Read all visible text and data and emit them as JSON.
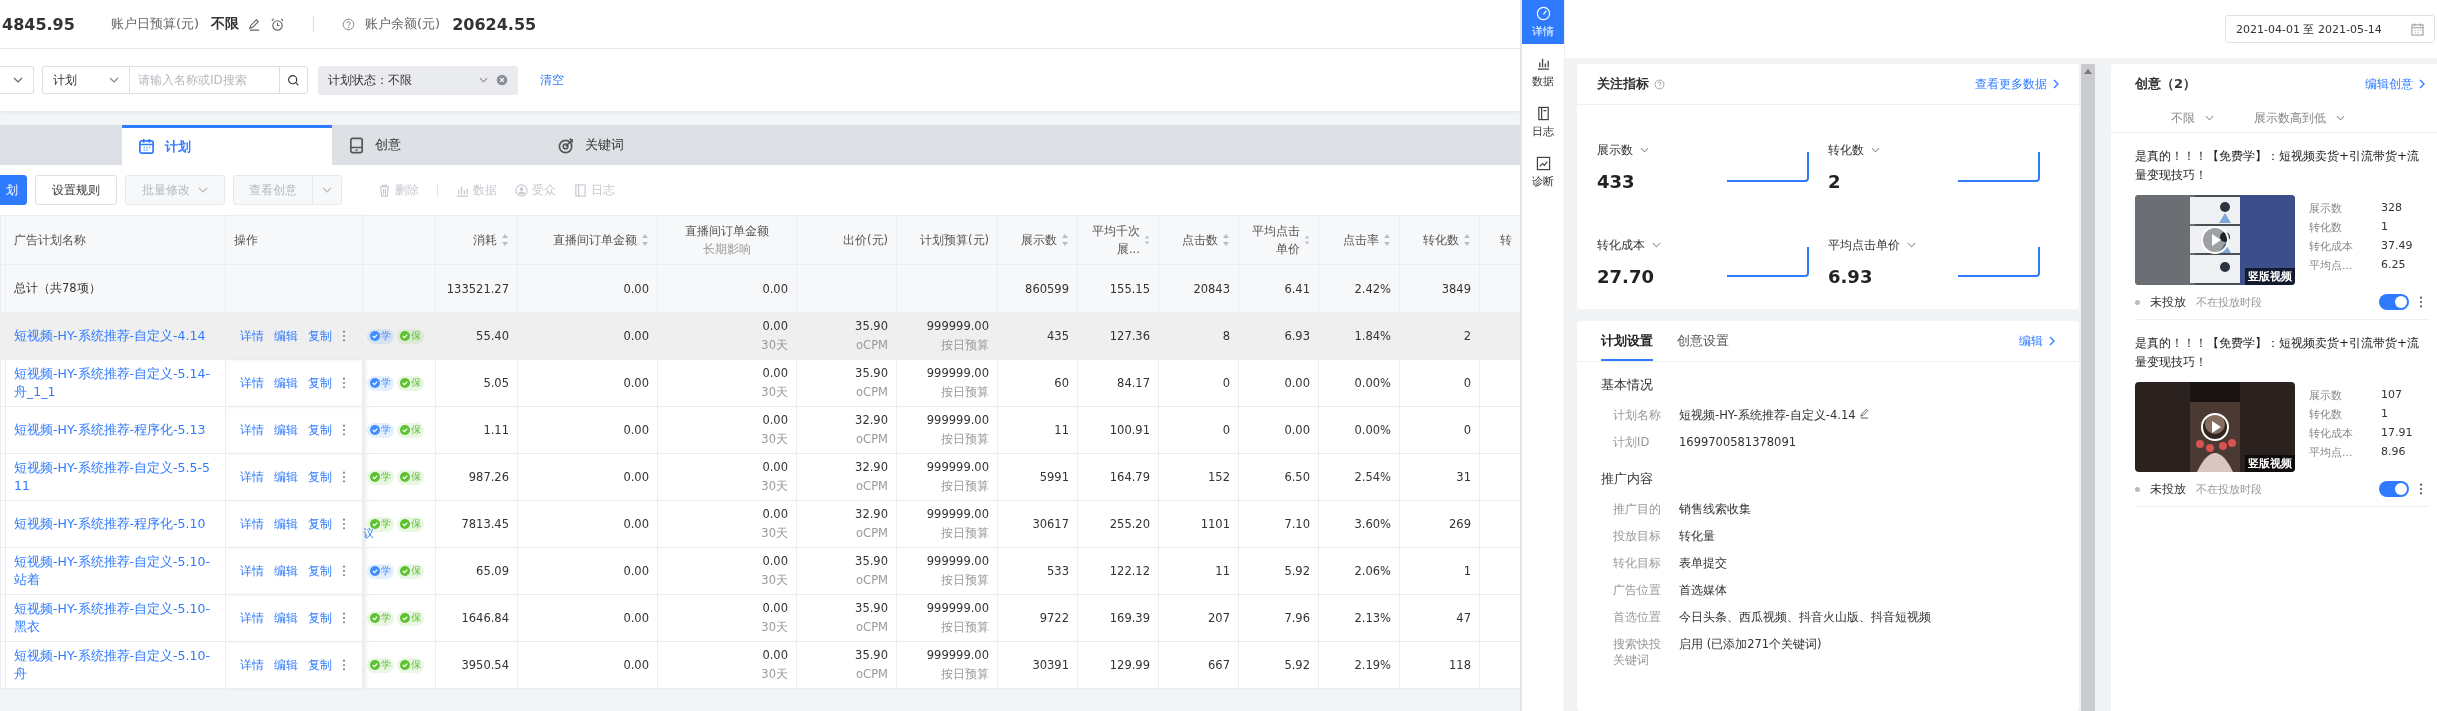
{
  "account": {
    "spend": "4845.95",
    "daily_budget_label": "账户日预算(元)",
    "daily_budget": "不限",
    "balance_label": "账户余额(元)",
    "balance": "20624.55"
  },
  "filters": {
    "level": "计划",
    "search_placeholder": "请输入名称或ID搜索",
    "status_tag": "计划状态：不限",
    "clear": "清空"
  },
  "tabs": [
    {
      "label": "计划",
      "kind": "plan",
      "selected": true
    },
    {
      "label": "创意",
      "kind": "creative",
      "selected": false
    },
    {
      "label": "关键词",
      "kind": "keyword",
      "selected": false
    }
  ],
  "toolbar": {
    "primary": "划",
    "rule": "设置规则",
    "batch": "批量修改",
    "view_creative": "查看创意",
    "actions": [
      {
        "label": "删除",
        "kind": "delete"
      },
      {
        "label": "数据",
        "kind": "data"
      },
      {
        "label": "受众",
        "kind": "audience"
      },
      {
        "label": "日志",
        "kind": "log"
      }
    ]
  },
  "columns": [
    {
      "label": "广告计划名称",
      "sortable": false
    },
    {
      "label": "操作",
      "sortable": false
    },
    {
      "label": "消耗",
      "sortable": true
    },
    {
      "label": "直播间订单金额",
      "sortable": true
    },
    {
      "label": "直播间订单金额",
      "sub": "长期影响",
      "sortable": false
    },
    {
      "label": "出价(元)",
      "sortable": false
    },
    {
      "label": "计划预算(元)",
      "sortable": false
    },
    {
      "label": "展示数",
      "sortable": true
    },
    {
      "label": "平均千次展...",
      "sortable": true
    },
    {
      "label": "点击数",
      "sortable": true
    },
    {
      "label": "平均点击单价",
      "sortable": true
    },
    {
      "label": "点击率",
      "sortable": true
    },
    {
      "label": "转化数",
      "sortable": true
    },
    {
      "label": "转",
      "sortable": false
    }
  ],
  "total": {
    "label": "总计（共78项）",
    "values": [
      "133521.27",
      "0.00",
      "0.00"
    ],
    "stats": [
      "860599",
      "155.15",
      "20843",
      "6.41",
      "2.42%",
      "3849"
    ]
  },
  "rows": [
    {
      "name": "短视频-HY-系统推荐-自定义-4.14",
      "highlighted": true,
      "actions": [
        "详情",
        "编辑",
        "复制"
      ],
      "tags": [
        {
          "label": "学",
          "color": "#3f8cff"
        },
        {
          "label": "保",
          "color": "#5cc230"
        }
      ],
      "values": [
        [
          "55.40"
        ],
        [
          "0.00"
        ],
        [
          "0.00",
          "30天"
        ],
        [
          "35.90",
          "oCPM"
        ],
        [
          "999999.00",
          "按日预算"
        ],
        [
          "435"
        ],
        [
          "127.36"
        ],
        [
          "8"
        ],
        [
          "6.93"
        ],
        [
          "1.84%"
        ],
        [
          "2"
        ]
      ]
    },
    {
      "name": "短视频-HY-系统推荐-自定义-5.14-舟_1_1",
      "highlighted": false,
      "actions": [
        "详情",
        "编辑",
        "复制"
      ],
      "tags": [
        {
          "label": "学",
          "color": "#3f8cff"
        },
        {
          "label": "保",
          "color": "#5cc230"
        }
      ],
      "values": [
        [
          "5.05"
        ],
        [
          "0.00"
        ],
        [
          "0.00",
          "30天"
        ],
        [
          "35.90",
          "oCPM"
        ],
        [
          "999999.00",
          "按日预算"
        ],
        [
          "60"
        ],
        [
          "84.17"
        ],
        [
          "0"
        ],
        [
          "0.00"
        ],
        [
          "0.00%"
        ],
        [
          "0"
        ]
      ]
    },
    {
      "name": "短视频-HY-系统推荐-程序化-5.13",
      "highlighted": false,
      "actions": [
        "详情",
        "编辑",
        "复制"
      ],
      "tags": [
        {
          "label": "学",
          "color": "#3f8cff"
        },
        {
          "label": "保",
          "color": "#5cc230"
        }
      ],
      "values": [
        [
          "1.11"
        ],
        [
          "0.00"
        ],
        [
          "0.00",
          "30天"
        ],
        [
          "32.90",
          "oCPM"
        ],
        [
          "999999.00",
          "按日预算"
        ],
        [
          "11"
        ],
        [
          "100.91"
        ],
        [
          "0"
        ],
        [
          "0.00"
        ],
        [
          "0.00%"
        ],
        [
          "0"
        ]
      ]
    },
    {
      "name": "短视频-HY-系统推荐-自定义-5.5-511",
      "highlighted": false,
      "actions": [
        "详情",
        "编辑",
        "复制"
      ],
      "tags": [
        {
          "label": "学",
          "color": "#5cc230"
        },
        {
          "label": "保",
          "color": "#5cc230"
        }
      ],
      "values": [
        [
          "987.26"
        ],
        [
          "0.00"
        ],
        [
          "0.00",
          "30天"
        ],
        [
          "32.90",
          "oCPM"
        ],
        [
          "999999.00",
          "按日预算"
        ],
        [
          "5991"
        ],
        [
          "164.79"
        ],
        [
          "152"
        ],
        [
          "6.50"
        ],
        [
          "2.54%"
        ],
        [
          "31"
        ]
      ]
    },
    {
      "name": "短视频-HY-系统推荐-程序化-5.10",
      "highlighted": false,
      "actions": [
        "详情",
        "编辑",
        "复制"
      ],
      "tags": [
        {
          "label": "学",
          "color": "#5cc230"
        },
        {
          "label": "保",
          "color": "#5cc230"
        }
      ],
      "note": "议",
      "values": [
        [
          "7813.45"
        ],
        [
          "0.00"
        ],
        [
          "0.00",
          "30天"
        ],
        [
          "32.90",
          "oCPM"
        ],
        [
          "999999.00",
          "按日预算"
        ],
        [
          "30617"
        ],
        [
          "255.20"
        ],
        [
          "1101"
        ],
        [
          "7.10"
        ],
        [
          "3.60%"
        ],
        [
          "269"
        ]
      ]
    },
    {
      "name": "短视频-HY-系统推荐-自定义-5.10-站着",
      "highlighted": false,
      "actions": [
        "详情",
        "编辑",
        "复制"
      ],
      "tags": [
        {
          "label": "学",
          "color": "#3f8cff"
        },
        {
          "label": "保",
          "color": "#5cc230"
        }
      ],
      "values": [
        [
          "65.09"
        ],
        [
          "0.00"
        ],
        [
          "0.00",
          "30天"
        ],
        [
          "35.90",
          "oCPM"
        ],
        [
          "999999.00",
          "按日预算"
        ],
        [
          "533"
        ],
        [
          "122.12"
        ],
        [
          "11"
        ],
        [
          "5.92"
        ],
        [
          "2.06%"
        ],
        [
          "1"
        ]
      ]
    },
    {
      "name": "短视频-HY-系统推荐-自定义-5.10-黑衣",
      "highlighted": false,
      "actions": [
        "详情",
        "编辑",
        "复制"
      ],
      "tags": [
        {
          "label": "学",
          "color": "#5cc230"
        },
        {
          "label": "保",
          "color": "#5cc230"
        }
      ],
      "values": [
        [
          "1646.84"
        ],
        [
          "0.00"
        ],
        [
          "0.00",
          "30天"
        ],
        [
          "35.90",
          "oCPM"
        ],
        [
          "999999.00",
          "按日预算"
        ],
        [
          "9722"
        ],
        [
          "169.39"
        ],
        [
          "207"
        ],
        [
          "7.96"
        ],
        [
          "2.13%"
        ],
        [
          "47"
        ]
      ]
    },
    {
      "name": "短视频-HY-系统推荐-自定义-5.10-舟",
      "highlighted": false,
      "actions": [
        "详情",
        "编辑",
        "复制"
      ],
      "tags": [
        {
          "label": "学",
          "color": "#5cc230"
        },
        {
          "label": "保",
          "color": "#5cc230"
        }
      ],
      "values": [
        [
          "3950.54"
        ],
        [
          "0.00"
        ],
        [
          "0.00",
          "30天"
        ],
        [
          "35.90",
          "oCPM"
        ],
        [
          "999999.00",
          "按日预算"
        ],
        [
          "30391"
        ],
        [
          "129.99"
        ],
        [
          "667"
        ],
        [
          "5.92"
        ],
        [
          "2.19%"
        ],
        [
          "118"
        ]
      ]
    }
  ],
  "drawer": {
    "nav": [
      {
        "label": "详情",
        "kind": "detail",
        "selected": true
      },
      {
        "label": "数据",
        "kind": "data",
        "selected": false
      },
      {
        "label": "日志",
        "kind": "log",
        "selected": false
      },
      {
        "label": "诊断",
        "kind": "diagnose",
        "selected": false
      }
    ],
    "date_range": "2021-04-01 至 2021-05-14",
    "metrics_title": "关注指标",
    "metrics_link": "查看更多数据",
    "metrics": [
      {
        "label": "展示数",
        "value": "433"
      },
      {
        "label": "转化数",
        "value": "2"
      },
      {
        "label": "转化成本",
        "value": "27.70"
      },
      {
        "label": "平均点击单价",
        "value": "6.93"
      }
    ],
    "settings_tabs": [
      {
        "label": "计划设置",
        "selected": true
      },
      {
        "label": "创意设置",
        "selected": false
      }
    ],
    "settings_link": "编辑",
    "sections": [
      {
        "title": "基本情况",
        "fields": [
          {
            "label": "计划名称",
            "value": "短视频-HY-系统推荐-自定义-4.14",
            "editable": true
          },
          {
            "label": "计划ID",
            "value": "1699700581378091",
            "editable": false
          }
        ]
      },
      {
        "title": "推广内容",
        "fields": [
          {
            "label": "推广目的",
            "value": "销售线索收集",
            "editable": false
          },
          {
            "label": "投放目标",
            "value": "转化量",
            "editable": false
          },
          {
            "label": "转化目标",
            "value": "表单提交",
            "editable": false
          },
          {
            "label": "广告位置",
            "value": "首选媒体",
            "editable": false
          },
          {
            "label": "首选位置",
            "value": "今日头条、西瓜视频、抖音火山版、抖音短视频",
            "editable": false
          },
          {
            "label": "搜索快投关键词",
            "value": "启用 (已添加271个关键词)",
            "editable": false
          }
        ]
      }
    ],
    "creatives_title": "创意（2）",
    "creatives_link": "编辑创意",
    "creative_filters": [
      "不限",
      "展示数高到低"
    ],
    "creatives": [
      {
        "title": "是真的！！！【免费学】：短视频卖货+引流带货+流量变现技巧！",
        "video_label": "竖版视频",
        "stats": [
          {
            "label": "展示数",
            "value": "328"
          },
          {
            "label": "转化数",
            "value": "1"
          },
          {
            "label": "转化成本",
            "value": "37.49"
          },
          {
            "label": "平均点...",
            "value": "6.25"
          }
        ],
        "status": "未投放",
        "status_note": "不在投放时段",
        "on": true
      },
      {
        "title": "是真的！！！【免费学】：短视频卖货+引流带货+流量变现技巧！",
        "video_label": "竖版视频",
        "stats": [
          {
            "label": "展示数",
            "value": "107"
          },
          {
            "label": "转化数",
            "value": "1"
          },
          {
            "label": "转化成本",
            "value": "17.91"
          },
          {
            "label": "平均点...",
            "value": "8.96"
          }
        ],
        "status": "未投放",
        "status_note": "不在投放时段",
        "on": true
      }
    ]
  }
}
